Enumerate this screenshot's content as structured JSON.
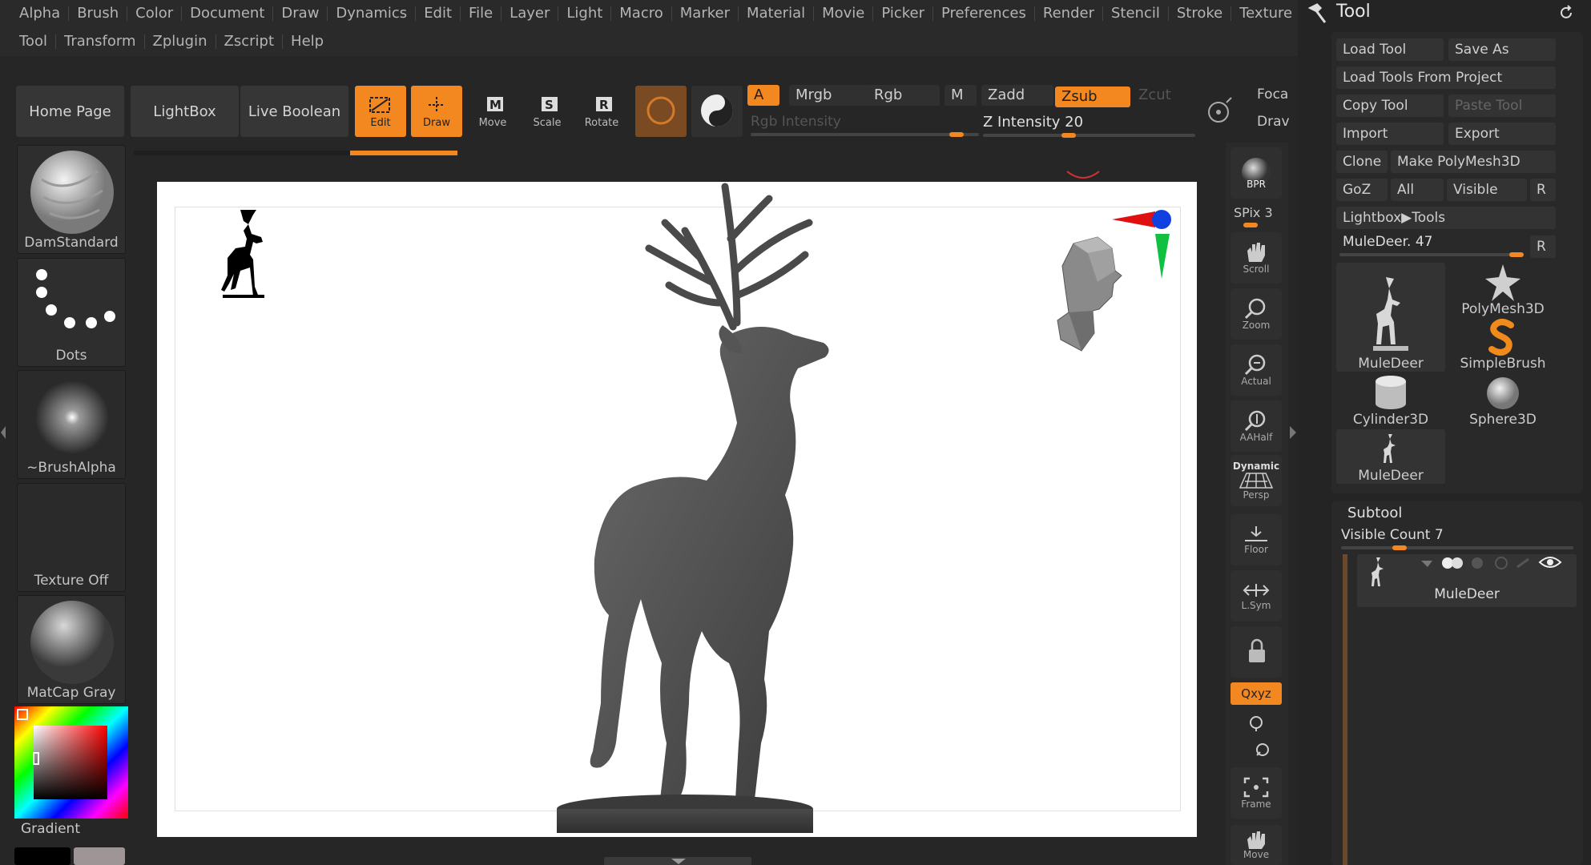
{
  "menus": {
    "row1": [
      "Alpha",
      "Brush",
      "Color",
      "Document",
      "Draw",
      "Dynamics",
      "Edit",
      "File",
      "Layer",
      "Light",
      "Macro",
      "Marker",
      "Material",
      "Movie",
      "Picker",
      "Preferences",
      "Render",
      "Stencil",
      "Stroke",
      "Texture"
    ],
    "row2": [
      "Tool",
      "Transform",
      "Zplugin",
      "Zscript",
      "Help"
    ]
  },
  "toolbar": {
    "home_page": "Home Page",
    "lightbox": "LightBox",
    "live_boolean": "Live Boolean",
    "edit": "Edit",
    "draw": "Draw",
    "move": "Move",
    "scale": "Scale",
    "rotate": "Rotate",
    "a_toggle": "A",
    "mrgb": "Mrgb",
    "rgb": "Rgb",
    "m": "M",
    "zadd": "Zadd",
    "zsub": "Zsub",
    "zcut": "Zcut",
    "rgb_intensity": "Rgb Intensity",
    "z_intensity": "Z Intensity 20",
    "z_intensity_value": 20,
    "focal": "Foca",
    "draw_size": "Drav"
  },
  "shelf": {
    "brush": "DamStandard",
    "stroke": "Dots",
    "alpha": "~BrushAlpha",
    "texture": "Texture Off",
    "material": "MatCap Gray",
    "gradient": "Gradient"
  },
  "strip": {
    "bpr": "BPR",
    "spix": "SPix 3",
    "scroll": "Scroll",
    "zoom": "Zoom",
    "actual": "Actual",
    "aahalf": "AAHalf",
    "dynamic": "Dynamic",
    "persp": "Persp",
    "floor": "Floor",
    "lsym": "L.Sym",
    "xyz": "Qxyz",
    "frame": "Frame",
    "move": "Move"
  },
  "tool_panel": {
    "title": "Tool",
    "load_tool": "Load Tool",
    "save_as": "Save As",
    "load_from_project": "Load Tools From Project",
    "copy_tool": "Copy Tool",
    "paste_tool": "Paste Tool",
    "import": "Import",
    "export": "Export",
    "clone": "Clone",
    "make_polymesh": "Make PolyMesh3D",
    "goz": "GoZ",
    "all": "All",
    "visible": "Visible",
    "r": "R",
    "lightbox_tools": "Lightbox▶Tools",
    "current_tool": "MuleDeer. 47",
    "current_tool_r": "R",
    "thumbs": [
      "MuleDeer",
      "PolyMesh3D",
      "SimpleBrush",
      "Cylinder3D",
      "Sphere3D",
      "MuleDeer"
    ],
    "subtool_title": "Subtool",
    "visible_count": "Visible Count 7",
    "subtool_item": "MuleDeer"
  },
  "colors": {
    "accent": "#f2881f",
    "background": "#262626",
    "canvas": "#ffffff"
  }
}
